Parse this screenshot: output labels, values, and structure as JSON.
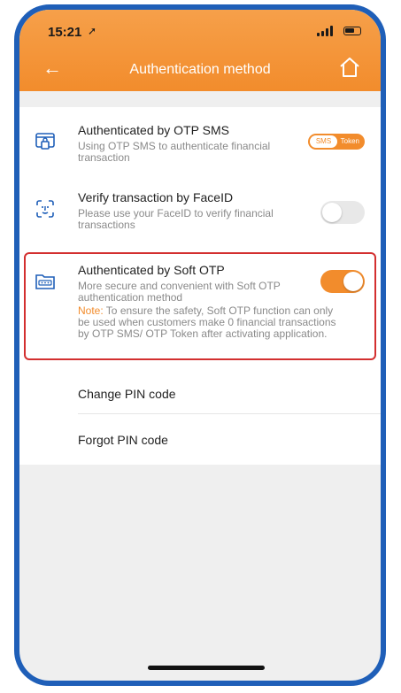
{
  "status_bar": {
    "time": "15:21",
    "location_glyph": "➚"
  },
  "header": {
    "back_glyph": "←",
    "title": "Authentication method"
  },
  "items": [
    {
      "title": "Authenticated by OTP SMS",
      "description": "Using OTP SMS to authenticate financial transaction",
      "control": {
        "type": "segment",
        "options": [
          "SMS",
          "Token"
        ],
        "selected": "SMS"
      }
    },
    {
      "title": "Verify transaction by FaceID",
      "description": "Please use your FaceID to verify financial transactions",
      "control": {
        "type": "toggle",
        "on": false
      }
    },
    {
      "title": "Authenticated by Soft OTP",
      "description": "More secure and convenient with Soft OTP authentication method",
      "note_label": "Note:",
      "note_text": " To ensure the safety, Soft OTP function can only be used when customers make 0 financial transactions by OTP SMS/ OTP Token after activating application.",
      "control": {
        "type": "toggle",
        "on": true
      }
    }
  ],
  "menu": {
    "change_pin": "Change PIN code",
    "forgot_pin": "Forgot PIN code"
  },
  "colors": {
    "accent": "#f28c2c",
    "highlight": "#d32f2f",
    "frame": "#1f5fb8"
  }
}
